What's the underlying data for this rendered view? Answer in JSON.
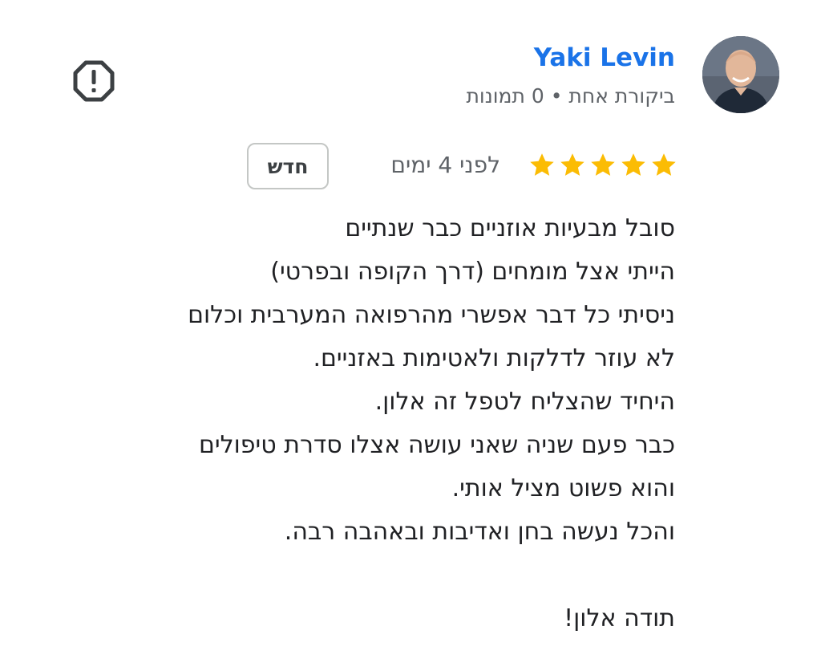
{
  "author": {
    "name": "Yaki Levin",
    "meta": "ביקורת אחת • 0 תמונות"
  },
  "review": {
    "rating": 5,
    "max_rating": 5,
    "time_ago": "לפני 4 ימים",
    "badge": "חדש",
    "lines": [
      "סובל מבעיות אוזניים כבר שנתיים",
      "הייתי אצל מומחים (דרך הקופה ובפרטי)",
      "ניסיתי כל דבר אפשרי מהרפואה המערבית וכלום",
      "לא עוזר לדלקות ולאטימות באזניים.",
      "היחיד שהצליח לטפל זה אלון.",
      "כבר פעם שניה שאני עושה אצלו סדרת טיפולים",
      "והוא פשוט מציל אותי.",
      "והכל נעשה בחן ואדיבות ובאהבה רבה.",
      "",
      "תודה אלון!"
    ]
  },
  "icons": {
    "report": "report-flag-icon",
    "star": "star-icon",
    "avatar": "avatar-photo"
  },
  "colors": {
    "author_name": "#1a73e8",
    "star": "#fbbc04",
    "meta_text": "#5f6368",
    "body_text": "#202124"
  }
}
